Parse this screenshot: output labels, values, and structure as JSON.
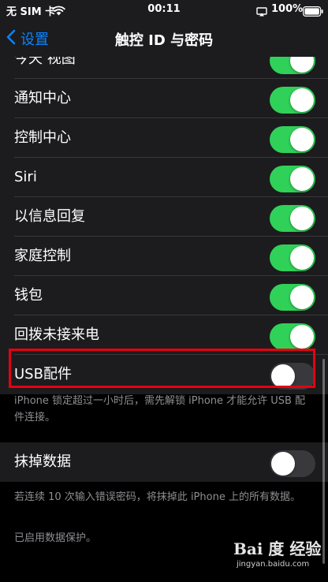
{
  "status_bar": {
    "carrier": "无 SIM 卡",
    "time": "00:11",
    "battery": "100%"
  },
  "nav": {
    "back_label": "设置",
    "title": "触控 ID 与密码"
  },
  "allow_access_rows": [
    {
      "label": "今天 视图",
      "on": true
    },
    {
      "label": "通知中心",
      "on": true
    },
    {
      "label": "控制中心",
      "on": true
    },
    {
      "label": "Siri",
      "on": true
    },
    {
      "label": "以信息回复",
      "on": true
    },
    {
      "label": "家庭控制",
      "on": true
    },
    {
      "label": "钱包",
      "on": true
    },
    {
      "label": "回拨未接来电",
      "on": true
    },
    {
      "label": "USB配件",
      "on": false
    }
  ],
  "usb_footer": "iPhone 锁定超过一小时后，需先解锁 iPhone 才能允许 USB 配件连接。",
  "erase_data": {
    "label": "抹掉数据",
    "on": false
  },
  "erase_footer": "若连续 10 次输入错误密码，将抹掉此 iPhone 上的所有数据。",
  "data_protection_note": "已启用数据保护。",
  "watermark": {
    "logo": "Bai 度 经验",
    "url": "jingyan.baidu.com"
  },
  "colors": {
    "toggle_on": "#30d158",
    "toggle_off": "#39393d",
    "accent": "#0a84ff",
    "highlight": "#e60012"
  }
}
